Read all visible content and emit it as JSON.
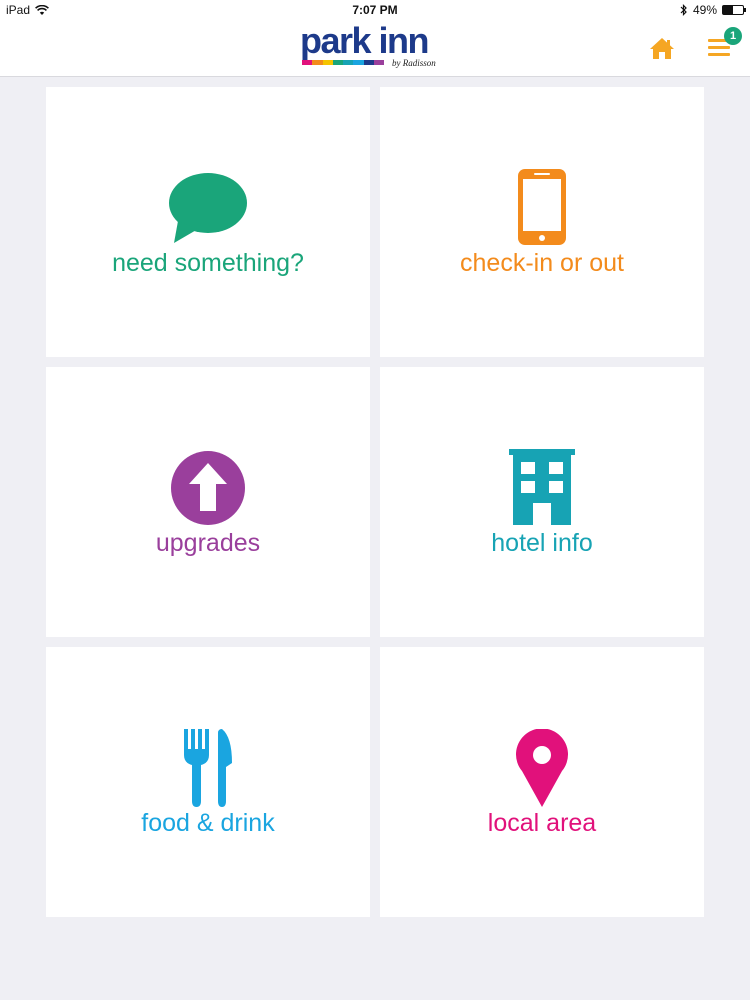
{
  "status_bar": {
    "device": "iPad",
    "time": "7:07 PM",
    "battery": "49%",
    "battery_level": 0.49
  },
  "header": {
    "logo_text": "park inn",
    "logo_sub": "by Radisson",
    "home_icon": "home-icon",
    "menu_icon": "hamburger-menu-icon",
    "menu_badge": "1",
    "accent_color": "#f5a623"
  },
  "tiles": [
    {
      "label": "need something?",
      "icon": "speech-bubble-icon",
      "color": "#1aa57a"
    },
    {
      "label": "check-in or out",
      "icon": "mobile-phone-icon",
      "color": "#f38b1c"
    },
    {
      "label": "upgrades",
      "icon": "arrow-up-circle-icon",
      "color": "#9a3f9c"
    },
    {
      "label": "hotel info",
      "icon": "building-icon",
      "color": "#17a3b4"
    },
    {
      "label": "food & drink",
      "icon": "fork-knife-icon",
      "color": "#1aa5e0"
    },
    {
      "label": "local area",
      "icon": "map-pin-icon",
      "color": "#e1117b"
    }
  ]
}
